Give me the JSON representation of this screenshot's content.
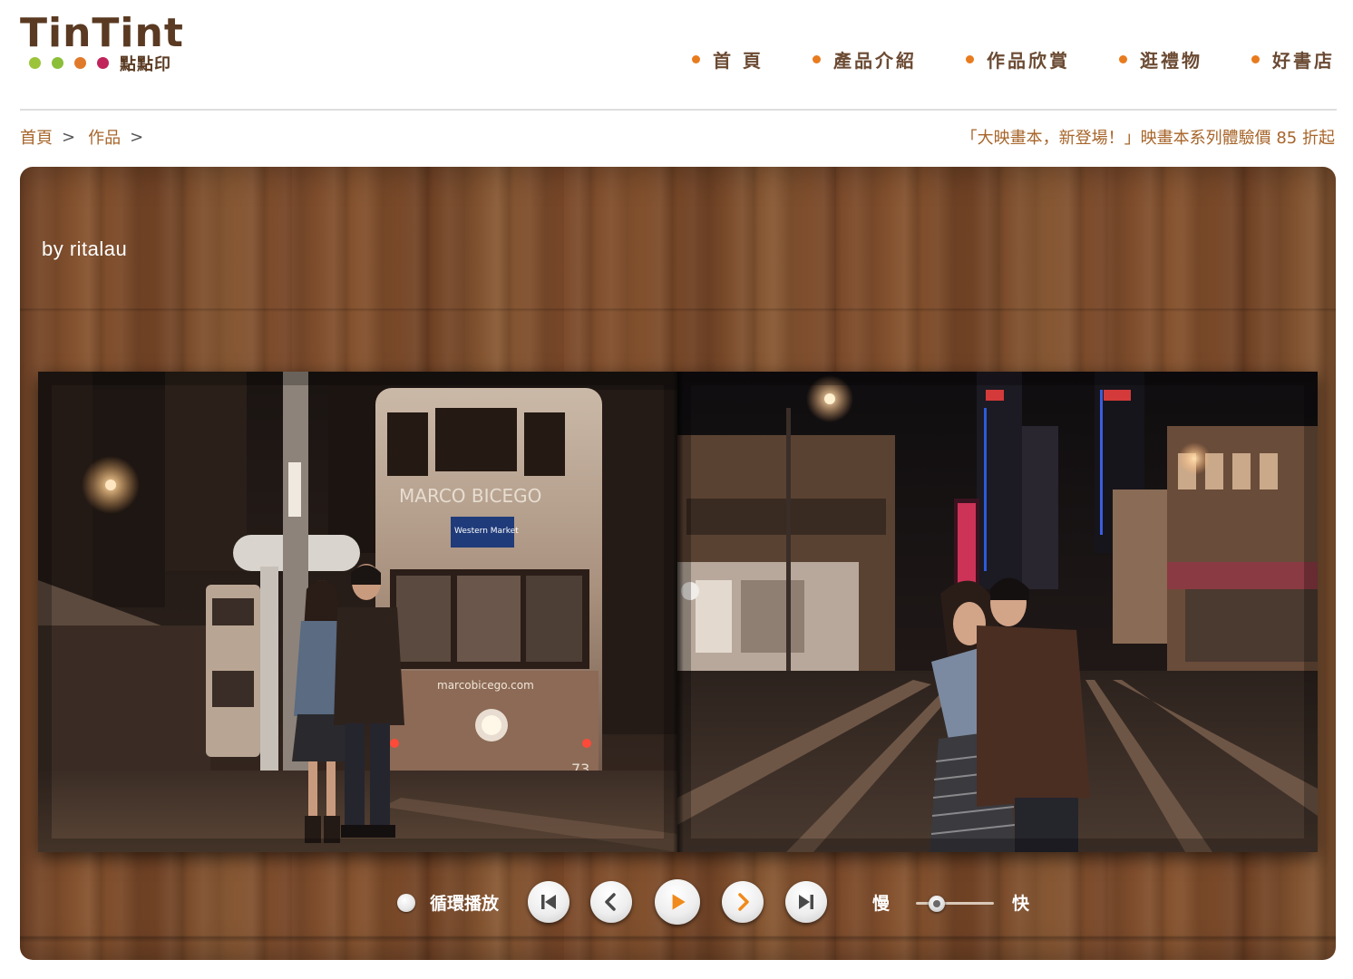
{
  "brand": {
    "logo_text": "TinTint",
    "logo_sub": "點點印",
    "dot_colors": [
      "#9cc43a",
      "#8bbf3a",
      "#e07a2a",
      "#c0245a"
    ]
  },
  "nav": {
    "items": [
      {
        "label": "首 頁"
      },
      {
        "label": "產品介紹"
      },
      {
        "label": "作品欣賞"
      },
      {
        "label": "逛禮物"
      },
      {
        "label": "好書店"
      }
    ],
    "bullet_color": "#e87b1e"
  },
  "breadcrumb": {
    "home": "首頁",
    "works": "作品",
    "separator": ">"
  },
  "promo": {
    "text": "「大映畫本，新登場！」映畫本系列體驗價 85 折起"
  },
  "viewer": {
    "author": "by ritalau"
  },
  "book": {
    "left_page": {
      "tram_brand": "MARCO BICEGO",
      "tram_site": "marcobicego.com",
      "tram_number": "73",
      "destination": "Western Market"
    },
    "right_page": {}
  },
  "controls": {
    "loop_label": "循環播放",
    "speed_slow_label": "慢",
    "speed_fast_label": "快",
    "speed_level": 0.2,
    "buttons": [
      {
        "name": "first-page-button",
        "icon": "skip-first-icon"
      },
      {
        "name": "prev-page-button",
        "icon": "chevron-left-icon"
      },
      {
        "name": "play-button",
        "icon": "play-icon"
      },
      {
        "name": "next-page-button",
        "icon": "chevron-right-icon"
      },
      {
        "name": "last-page-button",
        "icon": "skip-last-icon"
      }
    ],
    "accent": "#f08a1c"
  }
}
